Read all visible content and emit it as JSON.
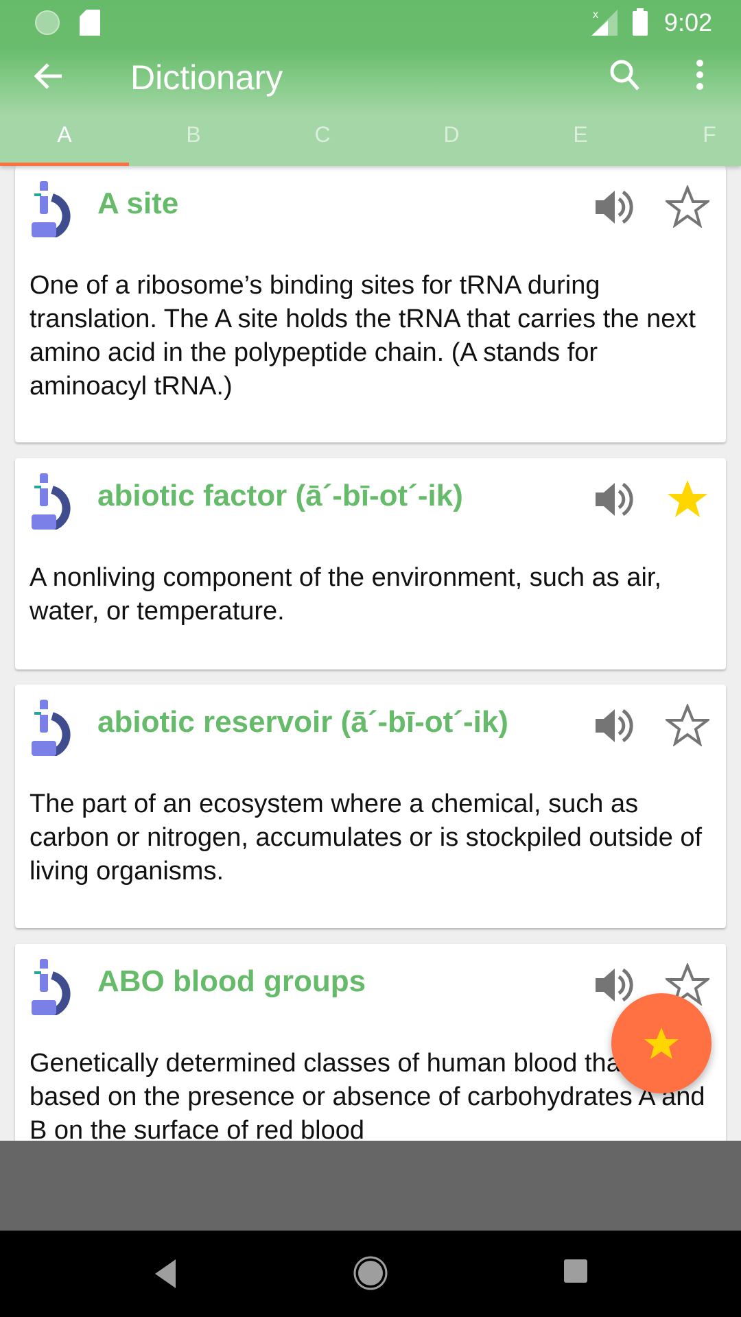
{
  "status_bar": {
    "time": "9:02",
    "icons": [
      "loading-icon",
      "sd-card-icon",
      "signal-off-icon",
      "battery-icon"
    ]
  },
  "toolbar": {
    "title": "Dictionary",
    "icons": [
      "back-arrow-icon",
      "search-icon",
      "more-vert-icon"
    ]
  },
  "tabs": [
    {
      "label": "A",
      "active": true
    },
    {
      "label": "B"
    },
    {
      "label": "C"
    },
    {
      "label": "D"
    },
    {
      "label": "E"
    },
    {
      "label": "F"
    }
  ],
  "entries": [
    {
      "term": "A site",
      "definition": "One of a ribosome’s binding sites for tRNA during translation. The A site holds the tRNA that carries the next amino acid in the polypeptide chain. (A stands for aminoacyl tRNA.)",
      "favorite": false
    },
    {
      "term": "abiotic factor (ā´-bī-ot´-ik)",
      "definition": "A nonliving component of the environment, such as air, water, or temperature.",
      "favorite": true
    },
    {
      "term": "abiotic reservoir (ā´-bī-ot´-ik)",
      "definition": "The part of an ecosystem where a chemical, such as carbon or nitrogen, accumulates or is stockpiled outside of living organisms.",
      "favorite": false
    },
    {
      "term": "ABO blood groups",
      "definition": "Genetically determined classes of human blood that are based on the presence or absence of carbohydrates A and B on the surface of red blood",
      "favorite": false
    }
  ],
  "colors": {
    "primary": "#66bb6a",
    "accent": "#ff7043",
    "favorite": "#ffd600"
  }
}
